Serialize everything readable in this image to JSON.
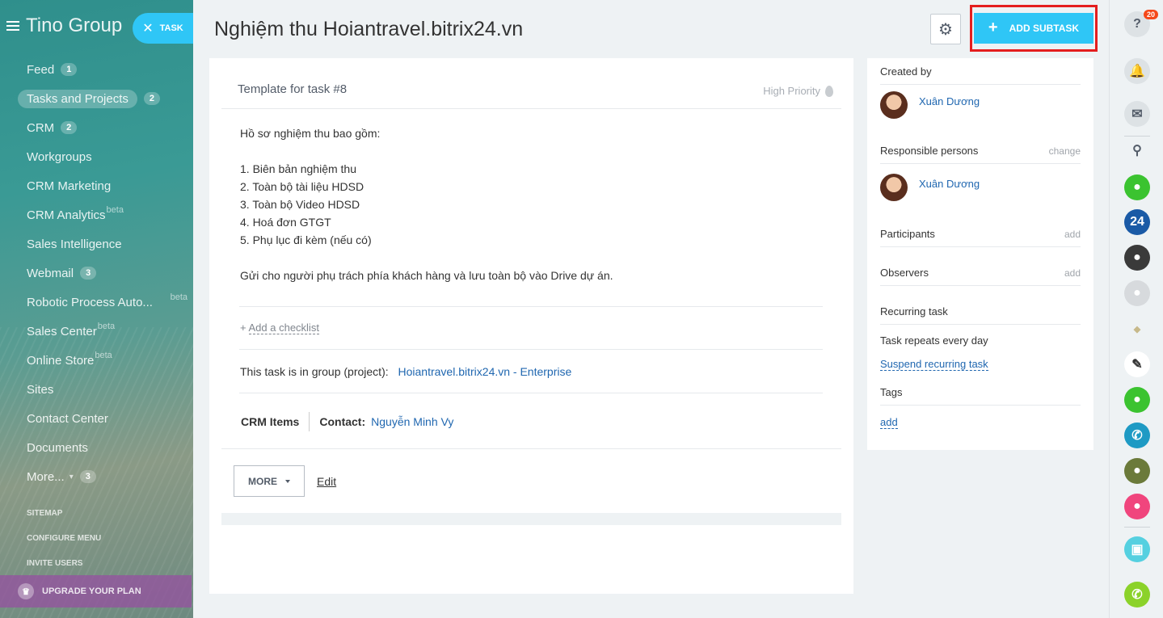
{
  "sidebar": {
    "brand": "Tino Group",
    "task_button": "TASK",
    "items": [
      {
        "label": "Feed",
        "badge": "1"
      },
      {
        "label": "Tasks and Projects",
        "badge": "2"
      },
      {
        "label": "CRM",
        "badge": "2"
      },
      {
        "label": "Workgroups"
      },
      {
        "label": "CRM Marketing"
      },
      {
        "label": "CRM Analytics",
        "beta": "beta"
      },
      {
        "label": "Sales Intelligence"
      },
      {
        "label": "Webmail",
        "badge": "3"
      },
      {
        "label": "Robotic Process Auto...",
        "beta": "beta"
      },
      {
        "label": "Sales Center",
        "beta": "beta"
      },
      {
        "label": "Online Store",
        "beta": "beta"
      },
      {
        "label": "Sites"
      },
      {
        "label": "Contact Center"
      },
      {
        "label": "Documents"
      },
      {
        "label": "More...",
        "badge": "3"
      }
    ],
    "sitemap": "SITEMAP",
    "configure_menu": "CONFIGURE MENU",
    "invite_users": "INVITE USERS",
    "upgrade": "UPGRADE YOUR PLAN"
  },
  "header": {
    "title": "Nghiệm thu Hoiantravel.bitrix24.vn",
    "add_subtask": "ADD SUBTASK"
  },
  "task": {
    "template_title": "Template for task #8",
    "priority": "High Priority",
    "description": [
      "Hồ sơ nghiệm thu bao gồm:",
      "",
      "1. Biên bản nghiệm thu",
      "2. Toàn bộ tài liệu HDSD",
      "3. Toàn bộ Video HDSD",
      "4. Hoá đơn GTGT",
      "5. Phụ lục đi kèm (nếu có)",
      "",
      "Gửi cho người phụ trách phía khách hàng và lưu toàn bộ vào Drive dự án."
    ],
    "add_checklist": "Add a checklist",
    "group_label": "This task is in group (project):",
    "group_link": "Hoiantravel.bitrix24.vn - Enterprise",
    "crm_items": "CRM Items",
    "contact_label": "Contact:",
    "contact_name": "Nguyễn Minh Vy",
    "more_button": "MORE",
    "edit_link": "Edit"
  },
  "panel": {
    "created_by": "Created by",
    "creator": "Xuân Dương",
    "responsible": "Responsible persons",
    "change": "change",
    "responsible_person": "Xuân Dương",
    "participants": "Participants",
    "observers": "Observers",
    "add": "add",
    "recurring": "Recurring task",
    "repeats": "Task repeats every day",
    "suspend": "Suspend recurring task",
    "tags": "Tags",
    "tags_add": "add"
  },
  "right_bar": {
    "notifications": "20",
    "bitrix_label": "24"
  },
  "colors": {
    "accent": "#2fc6f6",
    "link": "#2067b0",
    "highlight": "#e41e1e"
  }
}
